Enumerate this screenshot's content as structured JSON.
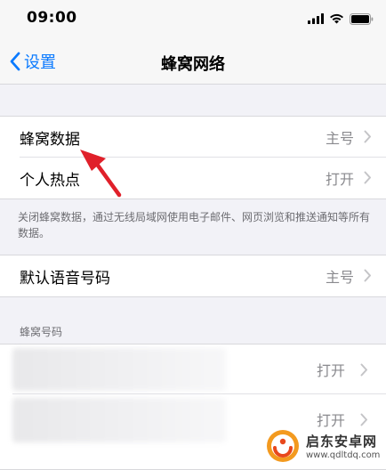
{
  "status_bar": {
    "time": "09:00",
    "icons": [
      "signal-icon",
      "wifi-icon",
      "battery-icon"
    ]
  },
  "nav": {
    "back_label": "设置",
    "title": "蜂窝网络"
  },
  "group1": {
    "rows": [
      {
        "label": "蜂窝数据",
        "value": "主号"
      },
      {
        "label": "个人热点",
        "value": "打开"
      }
    ]
  },
  "group1_footer": "关闭蜂窝数据，通过无线局域网使用电子邮件、网页浏览和推送通知等所有数据。",
  "group2": {
    "rows": [
      {
        "label": "默认语音号码",
        "value": "主号"
      }
    ]
  },
  "section_header": "蜂窝号码",
  "group3": {
    "rows": [
      {
        "label": "",
        "value": "打开"
      },
      {
        "label": "",
        "value": "打开"
      }
    ]
  },
  "watermark": {
    "name": "启东安卓网",
    "url": "www.qdltdq.com"
  },
  "colors": {
    "accent": "#0a7aff",
    "annotation_arrow": "#e0202a",
    "background": "#f2f2f7"
  }
}
